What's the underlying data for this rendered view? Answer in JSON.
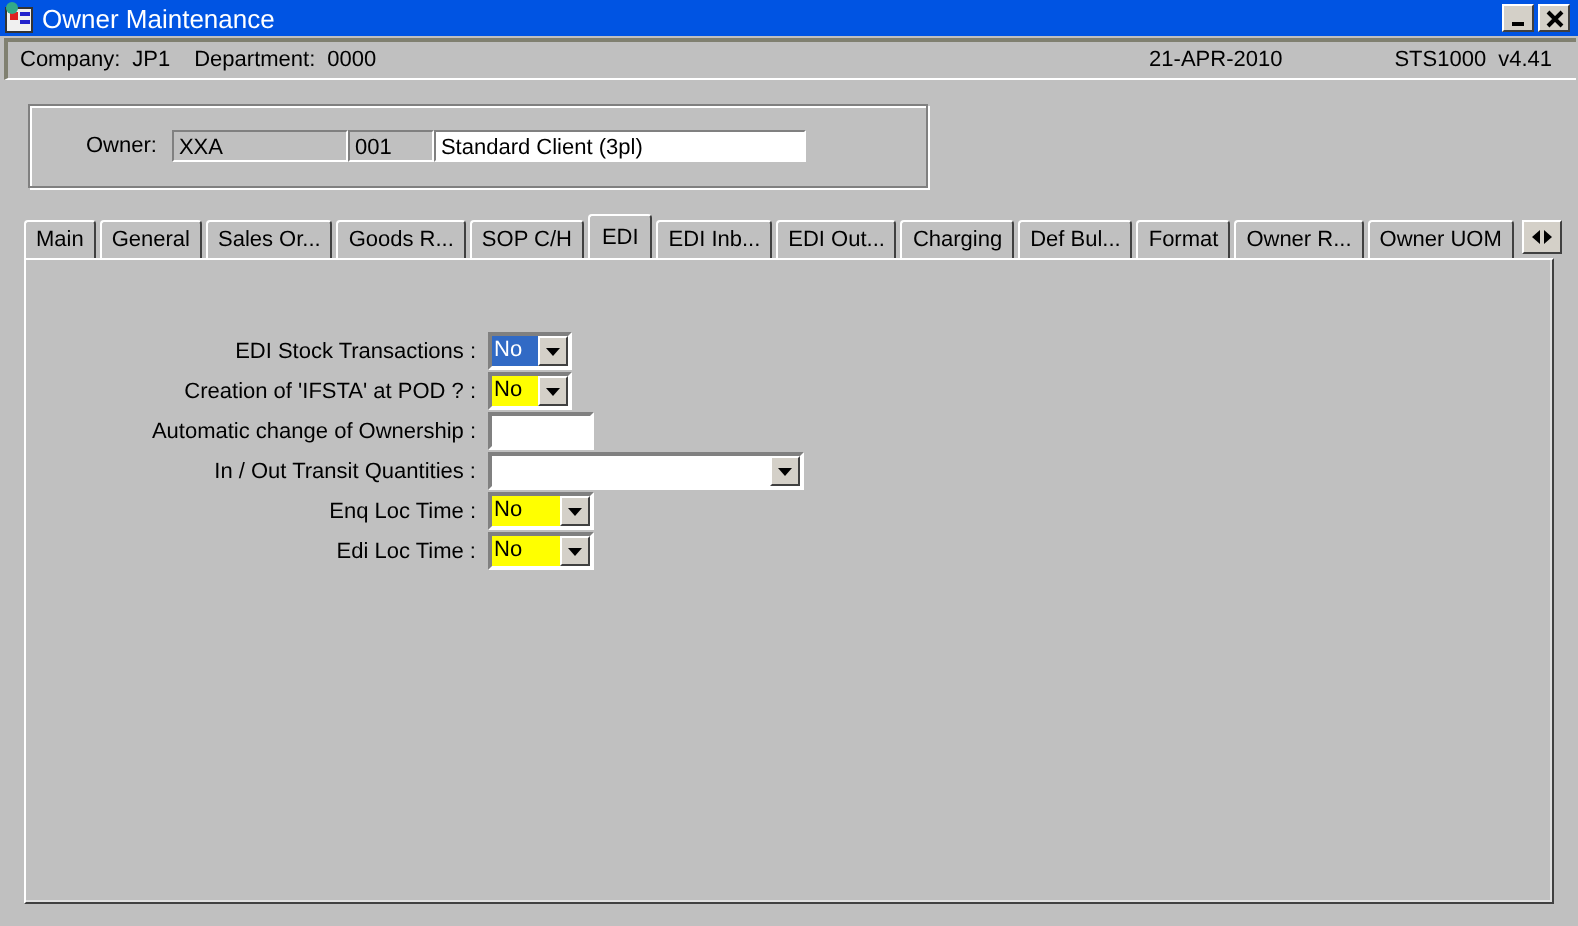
{
  "window": {
    "title": "Owner Maintenance"
  },
  "info_bar": {
    "company_label": "Company:",
    "company": "JP1",
    "department_label": "Department:",
    "department": "0000",
    "date": "21-APR-2010",
    "program": "STS1000",
    "version": "v4.41"
  },
  "owner": {
    "label": "Owner:",
    "code": "XXA",
    "number": "001",
    "name": "Standard Client (3pl)"
  },
  "tabs": [
    {
      "label": "Main",
      "selected": false
    },
    {
      "label": "General",
      "selected": false
    },
    {
      "label": "Sales Or...",
      "selected": false
    },
    {
      "label": "Goods R...",
      "selected": false
    },
    {
      "label": "SOP C/H",
      "selected": false
    },
    {
      "label": "EDI",
      "selected": true
    },
    {
      "label": "EDI Inb...",
      "selected": false
    },
    {
      "label": "EDI Out...",
      "selected": false
    },
    {
      "label": "Charging",
      "selected": false
    },
    {
      "label": "Def Bul...",
      "selected": false
    },
    {
      "label": "Format",
      "selected": false
    },
    {
      "label": "Owner R...",
      "selected": false
    },
    {
      "label": "Owner UOM",
      "selected": false
    }
  ],
  "fields": [
    {
      "label": "EDI Stock Transactions :",
      "kind": "dropdown",
      "value": "No",
      "focused": true,
      "highlighted": false
    },
    {
      "label": "Creation of 'IFSTA' at POD ? :",
      "kind": "dropdown",
      "value": "No",
      "focused": false,
      "highlighted": true
    },
    {
      "label": "Automatic change of Ownership :",
      "kind": "text",
      "focused": false,
      "highlighted": false
    },
    {
      "label": "In / Out Transit Quantities :",
      "kind": "dropdown",
      "focused": false,
      "highlighted": false
    },
    {
      "label": "Enq Loc Time :",
      "kind": "dropdown",
      "value": "No",
      "focused": false,
      "highlighted": true
    },
    {
      "label": "Edi Loc Time :",
      "kind": "dropdown",
      "value": "No",
      "focused": false,
      "highlighted": true
    }
  ]
}
